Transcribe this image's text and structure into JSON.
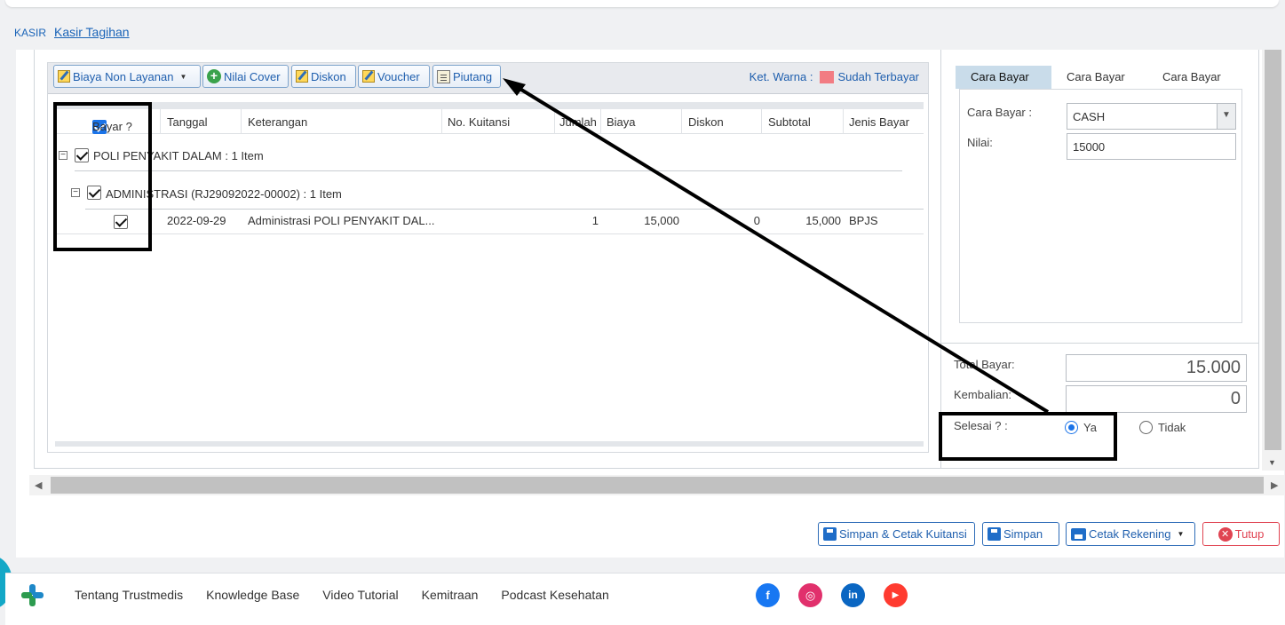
{
  "breadcrumb": {
    "root": "KASIR",
    "current": "Kasir Tagihan"
  },
  "toolbar": {
    "biaya_non_layanan": "Biaya Non Layanan",
    "nilai_cover": "Nilai Cover",
    "diskon": "Diskon",
    "voucher": "Voucher",
    "piutang": "Piutang",
    "ket_warna": "Ket. Warna :",
    "sudah_terbayar": "Sudah Terbayar",
    "legend_color": "#f27c83"
  },
  "grid": {
    "columns": [
      "Bayar ?",
      "Tanggal",
      "Keterangan",
      "No. Kuitansi",
      "Jumlah",
      "Biaya",
      "Diskon",
      "Subtotal",
      "Jenis Bayar"
    ],
    "group1": "POLI PENYAKIT DALAM : 1 Item",
    "group2": "ADMINISTRASI (RJ29092022-00002) : 1 Item",
    "rows": [
      {
        "tanggal": "2022-09-29",
        "keterangan": "Administrasi POLI PENYAKIT DAL...",
        "no_kuitansi": "",
        "jumlah": "1",
        "biaya": "15,000",
        "diskon": "0",
        "subtotal": "15,000",
        "jenis_bayar": "BPJS"
      }
    ]
  },
  "payment": {
    "tabs": [
      "Cara Bayar 1",
      "Cara Bayar 2",
      "Cara Bayar 3"
    ],
    "cara_bayar_label": "Cara Bayar :",
    "cara_bayar_value": "CASH",
    "nilai_label": "Nilai:",
    "nilai_value": "15000",
    "total_bayar_label": "Total Bayar:",
    "total_bayar_value": "15.000",
    "kembalian_label": "Kembalian:",
    "kembalian_value": "0",
    "selesai_label": "Selesai ? :",
    "ya": "Ya",
    "tidak": "Tidak"
  },
  "actions": {
    "simpan_cetak": "Simpan & Cetak Kuitansi",
    "simpan": "Simpan",
    "cetak_rekening": "Cetak Rekening",
    "tutup": "Tutup"
  },
  "footer": {
    "links": [
      "Tentang Trustmedis",
      "Knowledge Base",
      "Video Tutorial",
      "Kemitraan",
      "Podcast Kesehatan"
    ],
    "social": [
      "facebook-icon",
      "instagram-icon",
      "linkedin-icon",
      "youtube-icon"
    ]
  },
  "colors": {
    "accent": "#1f5fae",
    "danger": "#e04452",
    "highlight": "#000000"
  }
}
